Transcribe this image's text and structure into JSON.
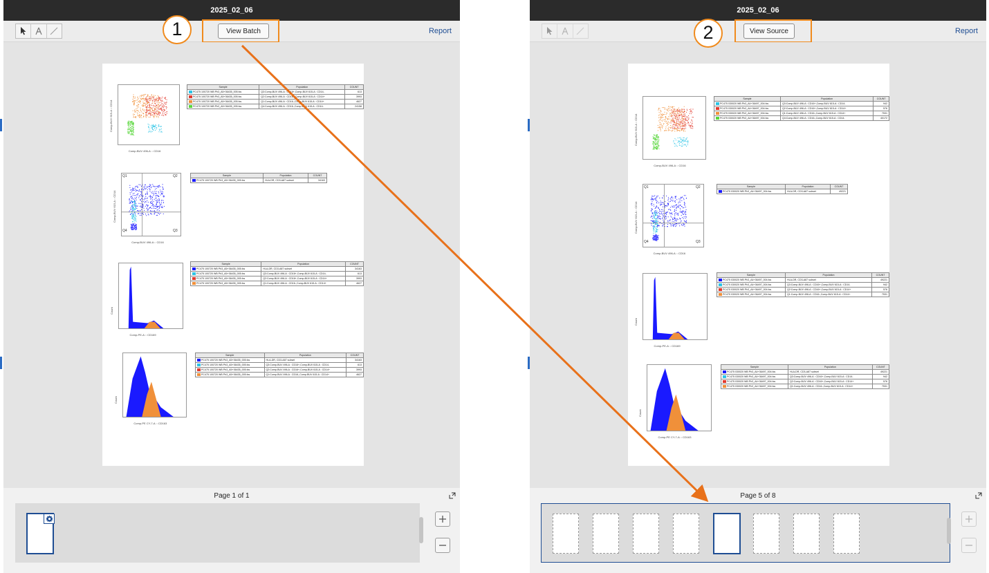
{
  "left_panel": {
    "title": "2025_02_06",
    "toolbar_button": "View Batch",
    "report_link": "Report",
    "callout": "1",
    "page_indicator": "Page 1 of 1",
    "tables": [
      {
        "headers": [
          "Sample",
          "Population",
          "COUNT"
        ],
        "rows": [
          {
            "color": "#2ac4e6",
            "sample": "PC475 100720 WB Ph3_A5+36435_005.fcs",
            "population": "Q3:Comp-BUV 496-A : CD16+,Comp-BUV 615-A : CD14-",
            "count": "613"
          },
          {
            "color": "#e23a2e",
            "sample": "PC475 100720 WB Ph3_A5+36435_005.fcs",
            "population": "Q2:Comp-BUV 496-A : CD16+,Comp-BUV 615-A : CD14+",
            "count": "3993"
          },
          {
            "color": "#f0903a",
            "sample": "PC475 100720 WB Ph3_A5+36435_005.fcs",
            "population": "Q1:Comp-BUV 496-A : CD16-,Comp-BUV 615-A : CD14+",
            "count": "4627"
          },
          {
            "color": "#57d63a",
            "sample": "PC475 100720 WB Ph3_A5+36435_005.fcs",
            "population": "Q4:Comp-BUV 496-A : CD16-,Comp-BUV 615-A : CD14-",
            "count": "24158"
          }
        ]
      },
      {
        "headers": [
          "Sample",
          "Population",
          "COUNT"
        ],
        "rows": [
          {
            "color": "#1a1aff",
            "sample": "PC475 100720 WB Ph3_A5+36435_005.fcs",
            "population": "HLA-DR, CD3-A87 subset",
            "count": "34163"
          }
        ]
      },
      {
        "headers": [
          "Sample",
          "Population",
          "COUNT"
        ],
        "rows": [
          {
            "color": "#1a1aff",
            "sample": "PC475 100720 WB Ph3_A5+36435_005.fcs",
            "population": "HLA-DR, CD3-A87 subset",
            "count": "34163"
          },
          {
            "color": "#2ac4e6",
            "sample": "PC475 100720 WB Ph3_A5+36435_005.fcs",
            "population": "Q3:Comp-BUV 496-A : CD16+,Comp-BUV 615-A : CD14-",
            "count": "613"
          },
          {
            "color": "#e23a2e",
            "sample": "PC475 100720 WB Ph3_A5+36435_005.fcs",
            "population": "Q2:Comp-BUV 496-A : CD16+,Comp-BUV 615-A : CD14+",
            "count": "3993"
          },
          {
            "color": "#f0903a",
            "sample": "PC475 100720 WB Ph3_A5+36435_005.fcs",
            "population": "Q1:Comp-BUV 496-A : CD16-,Comp-BUV 615-A : CD14+",
            "count": "4627"
          }
        ]
      },
      {
        "headers": [
          "Sample",
          "Population",
          "COUNT"
        ],
        "rows": [
          {
            "color": "#1a1aff",
            "sample": "PC475 100720 WB Ph3_A5+36435_005.fcs",
            "population": "HLA-DR, CD3-A87 subset",
            "count": "34163"
          },
          {
            "color": "#2ac4e6",
            "sample": "PC475 100720 WB Ph3_A5+36435_005.fcs",
            "population": "Q3:Comp-BUV 496-A : CD16+,Comp-BUV 615-A : CD14-",
            "count": "613"
          },
          {
            "color": "#e23a2e",
            "sample": "PC475 100720 WB Ph3_A5+36435_005.fcs",
            "population": "Q2:Comp-BUV 496-A : CD16+,Comp-BUV 615-A : CD14+",
            "count": "3993"
          },
          {
            "color": "#f0903a",
            "sample": "PC475 100720 WB Ph3_A5+36435_005.fcs",
            "population": "Q1:Comp-BUV 496-A : CD16-,Comp-BUV 615-A : CD14+",
            "count": "4627"
          }
        ]
      }
    ],
    "plot_xlabels": [
      "Comp-BUV 496-A :: CD16",
      "Comp-BUV 496-A :: CD16",
      "Comp-PE-A :: CD169",
      "Comp-PE CY-7-A :: CD163"
    ],
    "plot_ylabels": [
      "Comp-BUV 615-A :: CD14",
      "Comp-BUV 615-A :: CD14",
      "Count",
      "Count"
    ],
    "quadrants": [
      "Q1",
      "Q2",
      "Q4",
      "Q3"
    ]
  },
  "right_panel": {
    "title": "2025_02_06",
    "toolbar_button": "View Source",
    "report_link": "Report",
    "callout": "2",
    "page_indicator": "Page 5 of 8",
    "selected_thumbnail": 5,
    "thumbnail_count": 8,
    "tables": [
      {
        "headers": [
          "Sample",
          "Population",
          "COUNT"
        ],
        "rows": [
          {
            "color": "#2ac4e6",
            "sample": "PC475 030020 WB Ph3_A4+36497_004.fcs",
            "population": "Q3:Comp-BUV 496-A : CD16+,Comp-BUV 615-A : CD14-",
            "count": "942"
          },
          {
            "color": "#e23a2e",
            "sample": "PC475 030020 WB Ph3_A4+36497_004.fcs",
            "population": "Q2:Comp-BUV 496-A : CD16+,Comp-BUV 615-A : CD14+",
            "count": "576"
          },
          {
            "color": "#f0903a",
            "sample": "PC475 030020 WB Ph3_A4+36497_004.fcs",
            "population": "Q1:Comp-BUV 496-A : CD16-,Comp-BUV 615-A : CD14+",
            "count": "7531"
          },
          {
            "color": "#57d63a",
            "sample": "PC475 030020 WB Ph3_A4+36497_004.fcs",
            "population": "Q4:Comp-BUV 496-A : CD16-,Comp-BUV 615-A : CD14-",
            "count": "40172"
          }
        ]
      },
      {
        "headers": [
          "Sample",
          "Population",
          "COUNT"
        ],
        "rows": [
          {
            "color": "#1a1aff",
            "sample": "PC475 030020 WB Ph3_A4+36497_004.fcs",
            "population": "HLA-DR, CD3-A87 subset",
            "count": "49221"
          }
        ]
      },
      {
        "headers": [
          "Sample",
          "Population",
          "COUNT"
        ],
        "rows": [
          {
            "color": "#1a1aff",
            "sample": "PC475 030020 WB Ph3_A4+36497_004.fcs",
            "population": "HLA-DR, CD3-A87 subset",
            "count": "49221"
          },
          {
            "color": "#2ac4e6",
            "sample": "PC475 030020 WB Ph3_A4+36497_004.fcs",
            "population": "Q3:Comp-BUV 496-A : CD16+,Comp-BUV 615-A : CD14-",
            "count": "942"
          },
          {
            "color": "#e23a2e",
            "sample": "PC475 030020 WB Ph3_A4+36497_004.fcs",
            "population": "Q2:Comp-BUV 496-A : CD16+,Comp-BUV 615-A : CD14+",
            "count": "576"
          },
          {
            "color": "#f0903a",
            "sample": "PC475 030020 WB Ph3_A4+36497_004.fcs",
            "population": "Q1:Comp-BUV 496-A : CD16-,Comp-BUV 615-A : CD14+",
            "count": "7531"
          }
        ]
      },
      {
        "headers": [
          "Sample",
          "Population",
          "COUNT"
        ],
        "rows": [
          {
            "color": "#1a1aff",
            "sample": "PC475 030020 WB Ph3_A4+36497_004.fcs",
            "population": "HLA-DR, CD3-A87 subset",
            "count": "49221"
          },
          {
            "color": "#2ac4e6",
            "sample": "PC475 030020 WB Ph3_A4+36497_004.fcs",
            "population": "Q3:Comp-BUV 496-A : CD16+,Comp-BUV 615-A : CD14-",
            "count": "942"
          },
          {
            "color": "#e23a2e",
            "sample": "PC475 030020 WB Ph3_A4+36497_004.fcs",
            "population": "Q2:Comp-BUV 496-A : CD16+,Comp-BUV 615-A : CD14+",
            "count": "576"
          },
          {
            "color": "#f0903a",
            "sample": "PC475 030020 WB Ph3_A4+36497_004.fcs",
            "population": "Q1:Comp-BUV 496-A : CD16-,Comp-BUV 615-A : CD14+",
            "count": "7531"
          }
        ]
      }
    ],
    "plot_xlabels": [
      "Comp-BUV 496-A :: CD16",
      "Comp-BUV 496-A :: CD16",
      "Comp-PE-A :: CD169",
      "Comp-PE CY-7-A :: CD163"
    ],
    "plot_ylabels": [
      "Comp-BUV 615-A :: CD14",
      "Comp-BUV 615-A :: CD14",
      "Count",
      "Count"
    ],
    "quadrants": [
      "Q1",
      "Q2",
      "Q4",
      "Q3"
    ]
  },
  "colors": {
    "highlight": "#f08a1c",
    "link": "#1e4d93",
    "titlebar": "#2b2b2b",
    "selected_thumb": "#1e4d93"
  },
  "icons": [
    "pointer-icon",
    "text-icon",
    "line-icon",
    "gear-icon",
    "plus-icon",
    "minus-icon",
    "expand-icon"
  ]
}
